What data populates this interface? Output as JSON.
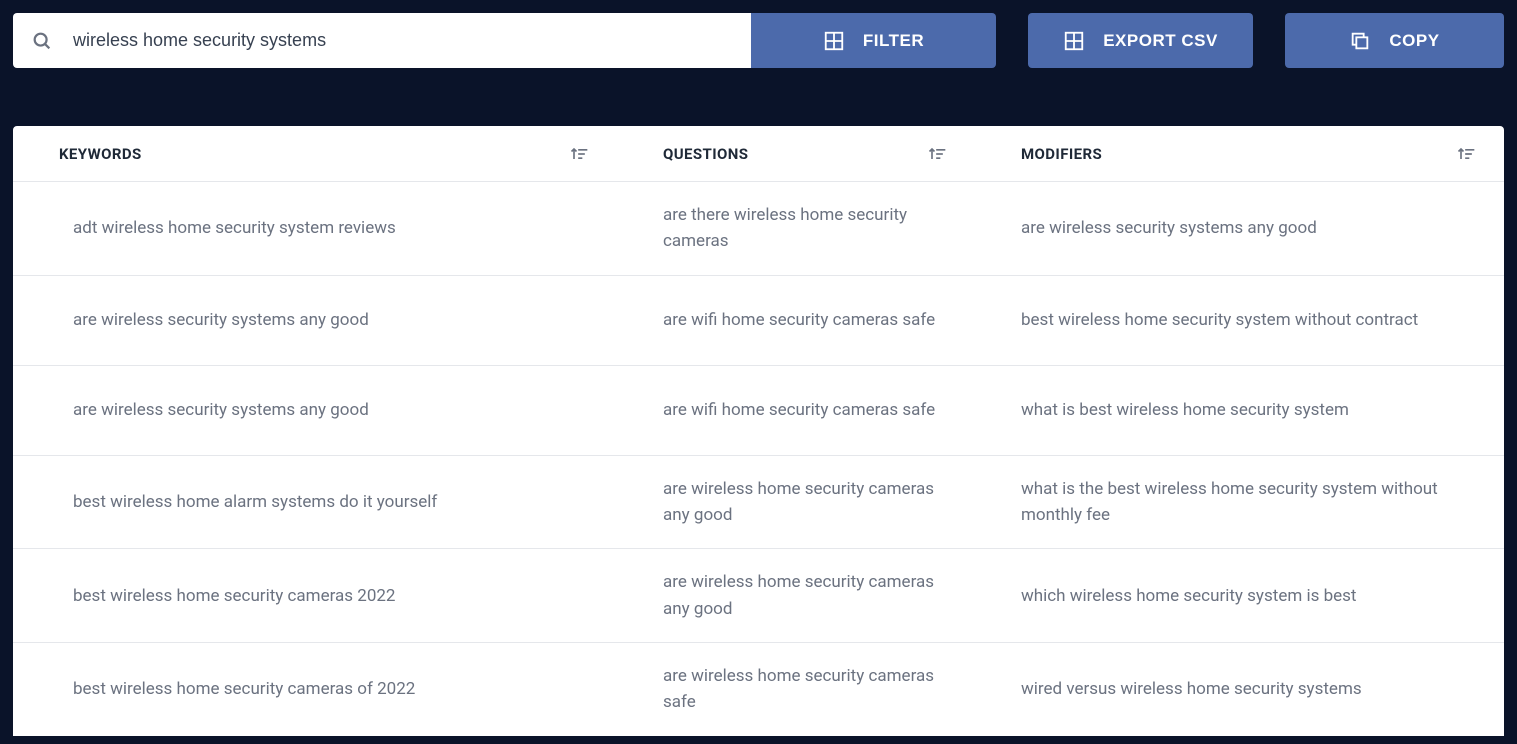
{
  "toolbar": {
    "search_value": "wireless home security systems",
    "filter_label": "FILTER",
    "export_label": "EXPORT CSV",
    "copy_label": "COPY"
  },
  "columns": {
    "keywords": "KEYWORDS",
    "questions": "QUESTIONS",
    "modifiers": "MODIFIERS"
  },
  "rows": [
    {
      "keyword": "adt wireless home security system reviews",
      "question": "are there wireless home security cameras",
      "modifier": "are wireless security systems any good"
    },
    {
      "keyword": "are wireless security systems any good",
      "question": "are wifi home security cameras safe",
      "modifier": "best wireless home security system without contract"
    },
    {
      "keyword": "are wireless security systems any good",
      "question": "are wifi home security cameras safe",
      "modifier": "what is best wireless home security system"
    },
    {
      "keyword": "best wireless home alarm systems do it yourself",
      "question": "are wireless home security cameras any good",
      "modifier": "what is the best wireless home security system without monthly fee"
    },
    {
      "keyword": "best wireless home security cameras 2022",
      "question": "are wireless home security cameras any good",
      "modifier": "which wireless home security system is best"
    },
    {
      "keyword": "best wireless home security cameras of 2022",
      "question": "are wireless home security cameras safe",
      "modifier": "wired versus wireless home security systems"
    }
  ]
}
